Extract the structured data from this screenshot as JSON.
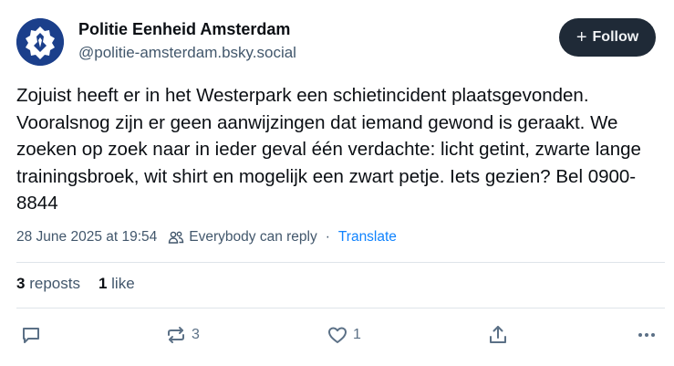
{
  "author": {
    "display_name": "Politie Eenheid Amsterdam",
    "handle": "@politie-amsterdam.bsky.social",
    "avatar_icon": "police-badge-icon",
    "avatar_color": "#1b3f8b"
  },
  "follow": {
    "label": "Follow",
    "icon": "plus-icon"
  },
  "post": {
    "text": "Zojuist heeft er in het Westerpark een schietincident plaatsgevonden. Vooralsnog zijn er geen aanwijzingen dat iemand gewond is geraakt. We zoeken op zoek naar in ieder geval één verdachte: licht getint, zwarte lange trainingsbroek, wit shirt en mogelijk een zwart petje. Iets gezien? Bel 0900-8844",
    "timestamp": "28 June 2025 at 19:54",
    "reply_setting": "Everybody can reply",
    "separator": "·",
    "translate_label": "Translate"
  },
  "stats": {
    "reposts_count": "3",
    "reposts_label": "reposts",
    "likes_count": "1",
    "likes_label": "like"
  },
  "actions": {
    "reply_icon": "reply-icon",
    "repost_icon": "repost-icon",
    "repost_count": "3",
    "like_icon": "heart-icon",
    "like_count": "1",
    "share_icon": "share-icon",
    "more_icon": "more-icon"
  },
  "colors": {
    "accent": "#1083fe",
    "button_bg": "#1f2a37",
    "muted_text": "#42576c"
  }
}
